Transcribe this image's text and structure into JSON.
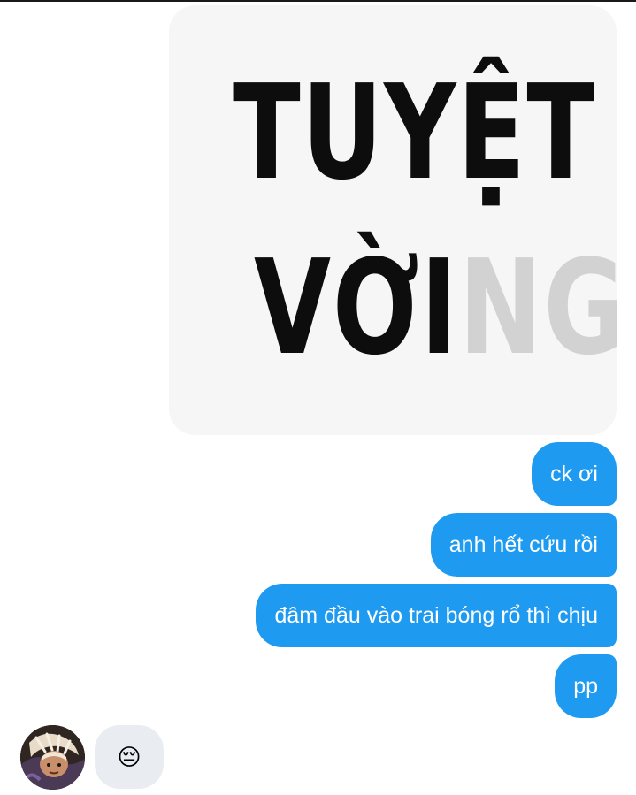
{
  "conversation": {
    "image_message": {
      "line1": "TUYỆT",
      "line2_main": "VỜI",
      "line2_faded": "NG"
    },
    "outgoing_messages": [
      "ck ơi",
      "anh hết cứu rồi",
      "đâm đầu vào trai bóng rổ thì chịu",
      "pp"
    ],
    "incoming_message": {
      "emoji": "😔"
    }
  },
  "colors": {
    "outgoing_bubble": "#1e9bf0",
    "incoming_bubble": "#e9edf1",
    "image_background": "#f5f6f5"
  }
}
